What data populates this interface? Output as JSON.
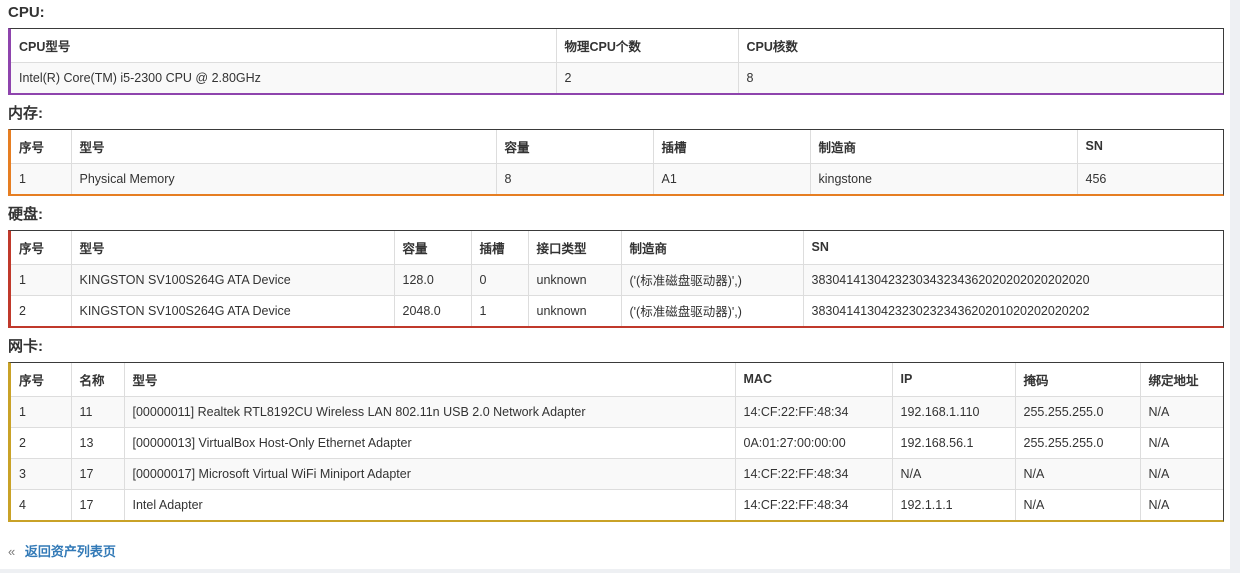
{
  "cpu": {
    "title": "CPU:",
    "headers": [
      "CPU型号",
      "物理CPU个数",
      "CPU核数"
    ],
    "rows": [
      [
        "Intel(R) Core(TM) i5-2300 CPU @ 2.80GHz",
        "2",
        "8"
      ]
    ]
  },
  "memory": {
    "title": "内存:",
    "headers": [
      "序号",
      "型号",
      "容量",
      "插槽",
      "制造商",
      "SN"
    ],
    "rows": [
      [
        "1",
        "Physical Memory",
        "8",
        "A1",
        "kingstone",
        "456"
      ]
    ]
  },
  "disk": {
    "title": "硬盘:",
    "headers": [
      "序号",
      "型号",
      "容量",
      "插槽",
      "接口类型",
      "制造商",
      "SN"
    ],
    "rows": [
      [
        "1",
        "KINGSTON SV100S264G ATA Device",
        "128.0",
        "0",
        "unknown",
        "('(标准磁盘驱动器)',)",
        "3830414130423230343234362020202020202020"
      ],
      [
        "2",
        "KINGSTON SV100S264G ATA Device",
        "2048.0",
        "1",
        "unknown",
        "('(标准磁盘驱动器)',)",
        "3830414130423230232343620201020202020202"
      ]
    ]
  },
  "nic": {
    "title": "网卡:",
    "headers": [
      "序号",
      "名称",
      "型号",
      "MAC",
      "IP",
      "掩码",
      "绑定地址"
    ],
    "rows": [
      [
        "1",
        "11",
        "[00000011] Realtek RTL8192CU Wireless LAN 802.11n USB 2.0 Network Adapter",
        "14:CF:22:FF:48:34",
        "192.168.1.110",
        "255.255.255.0",
        "N/A"
      ],
      [
        "2",
        "13",
        "[00000013] VirtualBox Host-Only Ethernet Adapter",
        "0A:01:27:00:00:00",
        "192.168.56.1",
        "255.255.255.0",
        "N/A"
      ],
      [
        "3",
        "17",
        "[00000017] Microsoft Virtual WiFi Miniport Adapter",
        "14:CF:22:FF:48:34",
        "N/A",
        "N/A",
        "N/A"
      ],
      [
        "4",
        "17",
        "Intel Adapter",
        "14:CF:22:FF:48:34",
        "192.1.1.1",
        "N/A",
        "N/A"
      ]
    ]
  },
  "footer": {
    "laquo": "«",
    "back_link": "返回资产列表页"
  }
}
